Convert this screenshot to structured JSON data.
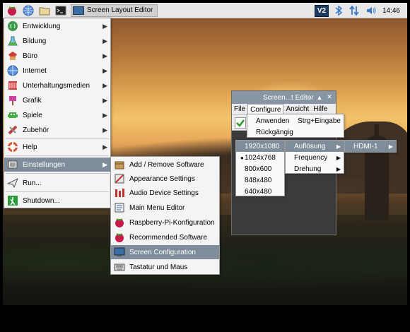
{
  "taskbar": {
    "window_title": "Screen Layout Editor",
    "vnc_label": "V2",
    "clock": "14:46"
  },
  "main_menu": {
    "items": [
      {
        "label": "Entwicklung",
        "icon": "development-icon",
        "submenu": true
      },
      {
        "label": "Bildung",
        "icon": "education-icon",
        "submenu": true
      },
      {
        "label": "Büro",
        "icon": "office-icon",
        "submenu": true
      },
      {
        "label": "Internet",
        "icon": "internet-icon",
        "submenu": true
      },
      {
        "label": "Unterhaltungsmedien",
        "icon": "multimedia-icon",
        "submenu": true
      },
      {
        "label": "Grafik",
        "icon": "graphics-icon",
        "submenu": true
      },
      {
        "label": "Spiele",
        "icon": "games-icon",
        "submenu": true
      },
      {
        "label": "Zubehör",
        "icon": "accessories-icon",
        "submenu": true
      },
      {
        "label": "Help",
        "icon": "help-icon",
        "submenu": true
      },
      {
        "label": "Einstellungen",
        "icon": "preferences-icon",
        "submenu": true
      },
      {
        "label": "Run...",
        "icon": "run-icon",
        "submenu": false
      },
      {
        "label": "Shutdown...",
        "icon": "shutdown-icon",
        "submenu": false
      }
    ]
  },
  "preferences_menu": {
    "items": [
      {
        "label": "Add / Remove Software"
      },
      {
        "label": "Appearance Settings"
      },
      {
        "label": "Audio Device Settings"
      },
      {
        "label": "Main Menu Editor"
      },
      {
        "label": "Raspberry-Pi-Konfiguration"
      },
      {
        "label": "Recommended Software"
      },
      {
        "label": "Screen Configuration"
      },
      {
        "label": "Tastatur und Maus"
      }
    ]
  },
  "window": {
    "title": "Screen...t Editor",
    "menubar": [
      "File",
      "Configure",
      "Ansicht",
      "Hilfe"
    ]
  },
  "configure_menu": {
    "apply_label": "Anwenden",
    "apply_shortcut": "Strg+Eingabe",
    "undo_label": "Rückgängig"
  },
  "hdmi_menu": {
    "items": [
      {
        "label": "Auflösung"
      },
      {
        "label": "Frequency"
      },
      {
        "label": "Drehung"
      }
    ]
  },
  "output_menu": {
    "label": "HDMI-1"
  },
  "resolution_menu": {
    "items": [
      "1920x1080",
      "1024x768",
      "800x600",
      "848x480",
      "640x480"
    ],
    "selected": "1024x768"
  },
  "colors": {
    "highlight": "#7f8d9b",
    "titlebar": "#8896a4",
    "menu_bg": "#f4f4f4"
  }
}
